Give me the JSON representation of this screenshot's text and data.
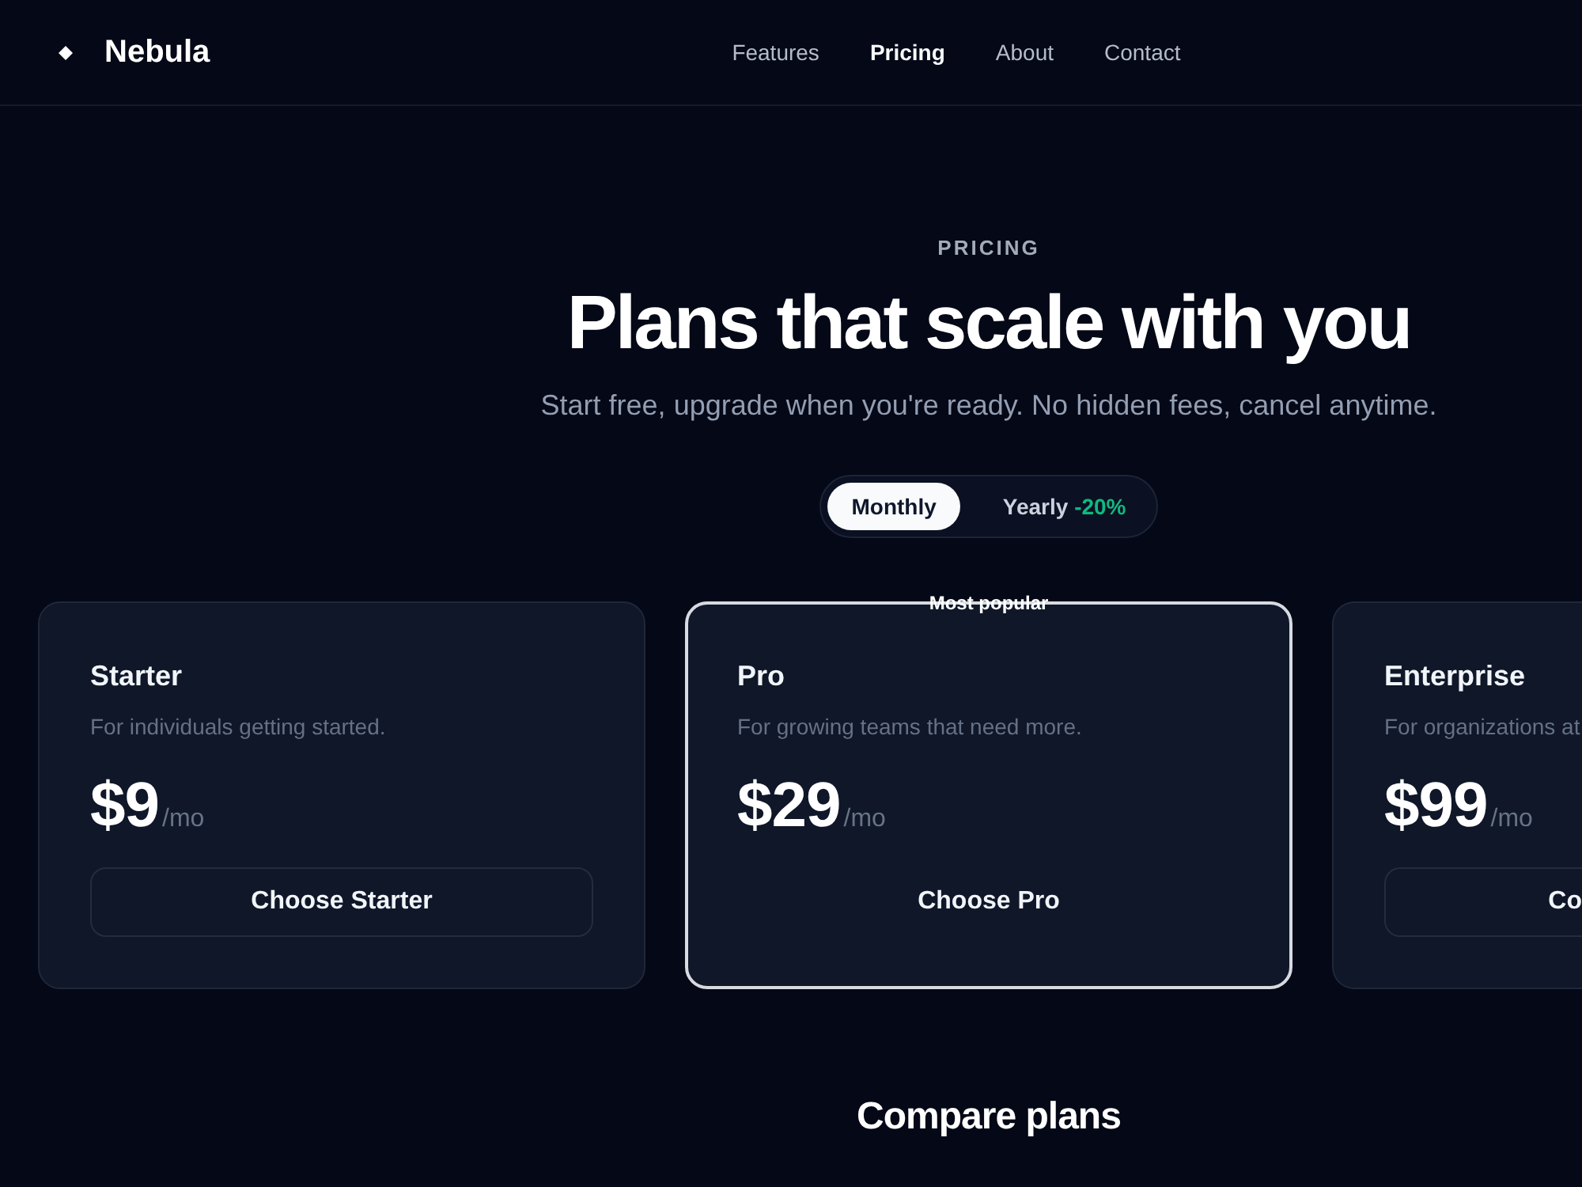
{
  "header": {
    "logo": "Nebula",
    "nav": [
      {
        "label": "Features",
        "selected": false
      },
      {
        "label": "Pricing",
        "selected": true
      },
      {
        "label": "About",
        "selected": false
      },
      {
        "label": "Contact",
        "selected": false
      }
    ]
  },
  "hero": {
    "eyebrow": "PRICING",
    "title": "Plans that scale with you",
    "subtitle": "Start free, upgrade when you're ready. No hidden fees, cancel anytime."
  },
  "billing_toggle": [
    {
      "label": "Monthly",
      "selected": true
    },
    {
      "label": "Yearly",
      "badge": "-20%",
      "selected": false
    }
  ],
  "plans": [
    {
      "name": "Starter",
      "description": "For individuals getting started.",
      "price": "$9",
      "period": "/mo",
      "button": "Choose Starter",
      "featured": false
    },
    {
      "name": "Pro",
      "badge": "Most popular",
      "description": "For growing teams that need more.",
      "price": "$29",
      "period": "/mo",
      "button": "Choose Pro",
      "featured": true
    },
    {
      "name": "Enterprise",
      "description": "For organizations at",
      "price": "$99",
      "period": "/mo",
      "button": "Co",
      "featured": false
    }
  ],
  "compare": {
    "title": "Compare plans"
  }
}
